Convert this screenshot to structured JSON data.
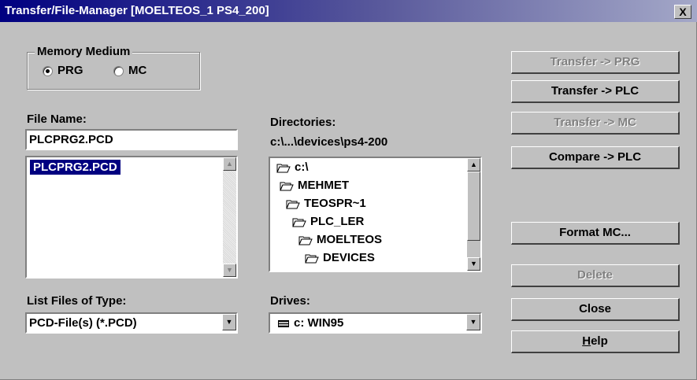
{
  "window": {
    "title": "Transfer/File-Manager [MOELTEOS_1 PS4_200]",
    "close_glyph": "X"
  },
  "memory_medium": {
    "legend": "Memory Medium",
    "options": [
      {
        "label": "PRG",
        "selected": true
      },
      {
        "label": "MC",
        "selected": false
      }
    ]
  },
  "file_name": {
    "label": "File Name:",
    "value": "PLCPRG2.PCD"
  },
  "file_list": {
    "items": [
      "PLCPRG2.PCD"
    ]
  },
  "list_type": {
    "label": "List Files of Type:",
    "value": "PCD-File(s) (*.PCD)"
  },
  "directories": {
    "label": "Directories:",
    "current_path": "c:\\...\\devices\\ps4-200",
    "items": [
      "c:\\",
      "MEHMET",
      "TEOSPR~1",
      "PLC_LER",
      "MOELTEOS",
      "DEVICES"
    ]
  },
  "drives": {
    "label": "Drives:",
    "value": "c: WIN95"
  },
  "buttons": {
    "transfer_prg": "Transfer -> PRG",
    "transfer_plc": "Transfer  -> PLC",
    "transfer_mc": "Transfer -> MC",
    "compare_plc": "Compare -> PLC",
    "format_mc": "Format MC...",
    "delete": "Delete",
    "close": "Close",
    "help_accel": "H",
    "help_rest": "elp"
  },
  "icons": {
    "folder": "folder-open-icon",
    "drive": "hard-drive-icon",
    "scroll_up": "arrow-up-icon",
    "scroll_down": "arrow-down-icon"
  }
}
